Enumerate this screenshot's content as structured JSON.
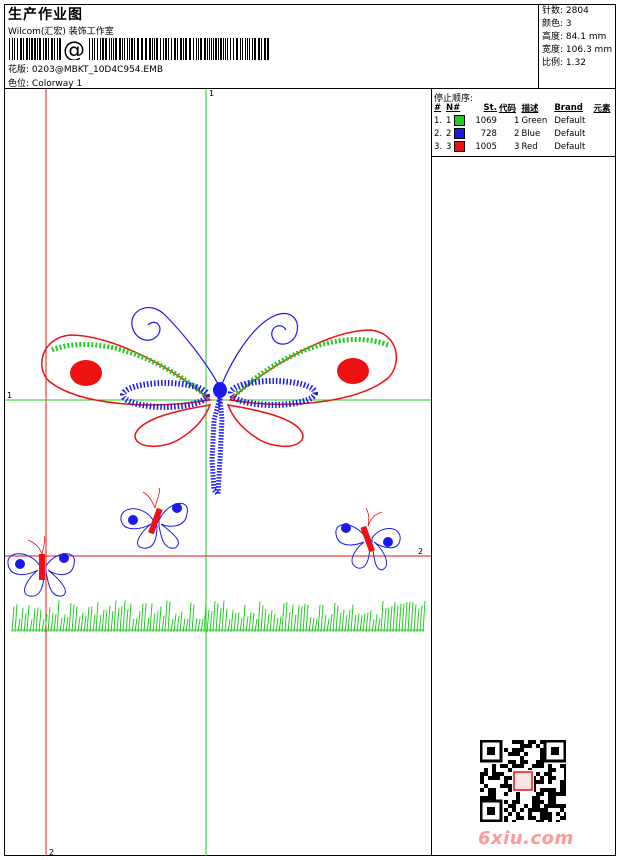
{
  "header": {
    "title": "生产作业图",
    "company": "Wilcom(汇宏) 装饰工作室",
    "barcode_text": "@",
    "file_label": "花版:",
    "file_name": "0203@MBKT_10D4C954.EMB",
    "colorway_label": "色位:",
    "colorway": "Colorway 1"
  },
  "specs": [
    {
      "label": "针数:",
      "value": "2804"
    },
    {
      "label": "颜色:",
      "value": "3"
    },
    {
      "label": "高度:",
      "value": "84.1 mm"
    },
    {
      "label": "宽度:",
      "value": "106.3 mm"
    },
    {
      "label": "比例:",
      "value": "1.32"
    }
  ],
  "stop_sequence": {
    "title": "停止顺序:",
    "headers": [
      "#",
      "N#",
      "St.",
      "代码",
      "描述",
      "Brand",
      "元素"
    ],
    "rows": [
      {
        "idx": "1.",
        "n": "1",
        "color": "#22cc22",
        "stitches": "1069",
        "code": "1",
        "desc": "Green",
        "brand": "Default"
      },
      {
        "idx": "2.",
        "n": "2",
        "color": "#1a1aee",
        "stitches": "728",
        "code": "2",
        "desc": "Blue",
        "brand": "Default"
      },
      {
        "idx": "3.",
        "n": "3",
        "color": "#ee1111",
        "stitches": "1005",
        "code": "3",
        "desc": "Red",
        "brand": "Default"
      }
    ]
  },
  "guides": {
    "v1": "1",
    "h1": "1",
    "h2": "2",
    "v2": "2"
  },
  "watermark": "6xiu.com",
  "colors": {
    "green": "#22cc22",
    "blue": "#1a1aee",
    "red": "#ee1111"
  }
}
